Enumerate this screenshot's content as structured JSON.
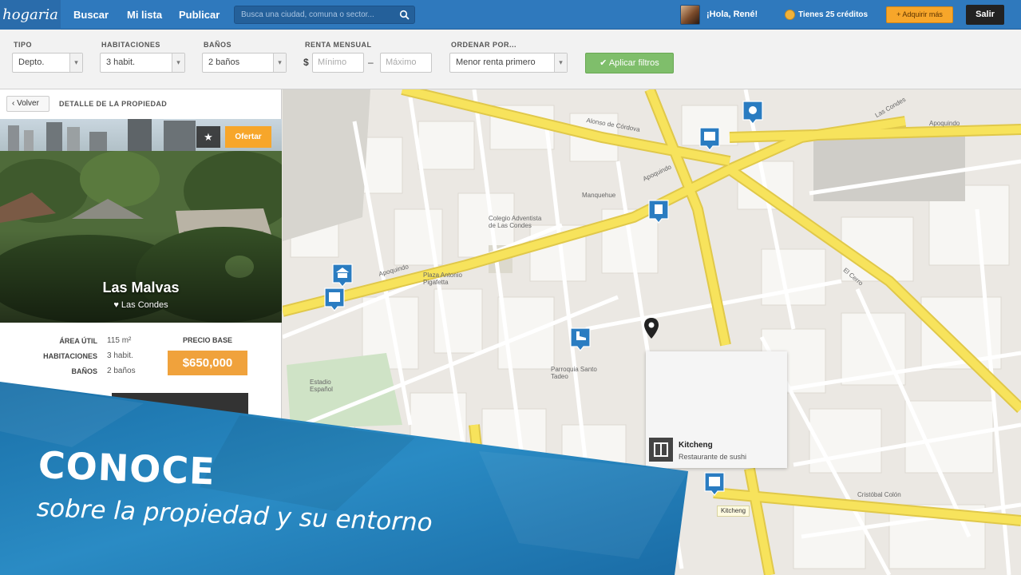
{
  "nav": {
    "logo": "hogaria",
    "links": [
      "Buscar",
      "Mi lista",
      "Publicar"
    ],
    "search_placeholder": "Busca una ciudad, comuna o sector...",
    "greeting": "¡Hola, René!",
    "credits": "Tienes 25 créditos",
    "buy_label": "+ Adquirir más",
    "exit_label": "Salir"
  },
  "filters": {
    "tipo_label": "TIPO",
    "tipo_value": "Depto.",
    "habitaciones_label": "HABITACIONES",
    "habitaciones_value": "3 habit.",
    "banos_label": "BAÑOS",
    "banos_value": "2 baños",
    "renta_label": "RENTA MENSUAL",
    "currency": "$",
    "min_placeholder": "Mínimo",
    "max_placeholder": "Máximo",
    "dash": "–",
    "ordenar_label": "ORDENAR POR...",
    "ordenar_value": "Menor renta primero",
    "apply_label": "✔ Aplicar filtros"
  },
  "detail": {
    "back_label": "‹ Volver",
    "section_title": "DETALLE DE LA PROPIEDAD",
    "offer_label": "Ofertar",
    "star_icon": "★",
    "name": "Las Malvas",
    "location": "♥ Las Condes",
    "specs": [
      {
        "label": "ÁREA ÚTIL",
        "value": "115 m²"
      },
      {
        "label": "HABITACIONES",
        "value": "3 habit."
      },
      {
        "label": "BAÑOS",
        "value": "2 baños"
      }
    ],
    "price_label": "PRECIO BASE",
    "price": "$650,000"
  },
  "map": {
    "labels": {
      "apoquindo_1": "Apoquindo",
      "apoquindo_2": "Apoquindo",
      "apoquindo_3": "Apoquindo",
      "las_condes": "Las Condes",
      "cordova": "Alonso de Córdova",
      "el_cerro": "El Cerro",
      "manquehue": "Manquehue",
      "colegio": "Colegio Adventista de Las Condes",
      "plaza": "Plaza Antonio Pigafetta",
      "estadio": "Estadio Español",
      "parroquia": "Parroquia Santo Tadeo",
      "colon": "Cristóbal Colón"
    },
    "info_name": "Kitcheng",
    "info_type": "Restaurante de sushi",
    "tag": "Kitcheng"
  },
  "banner": {
    "title": "CONOCE",
    "subtitle": "sobre la propiedad y su entorno"
  },
  "colors": {
    "nav": "#2f79bd",
    "accent_orange": "#f7a62a",
    "apply_green": "#7fbe6b",
    "banner_blue": "#1f7fb4",
    "road_yellow": "#f7e35c",
    "pin_blue": "#2a7cc1"
  }
}
